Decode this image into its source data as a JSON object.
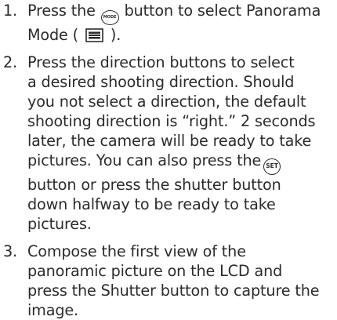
{
  "steps": [
    {
      "number": "1.",
      "text_before_icon": "Press the ",
      "icon_label": "MODE",
      "text_after_icon": " button to select Panorama",
      "line2_before_icon": "Mode ( ",
      "line2_after_icon": " )."
    },
    {
      "number": "2.",
      "lines": [
        "Press the direction buttons to select",
        "a desired shooting direction. Should",
        "you not select a direction, the default",
        "shooting direction is “right.” 2 seconds",
        "later, the camera will be ready to take"
      ],
      "line6_before_icon": "pictures. You can also press the",
      "icon_label": "SET",
      "lines_after": [
        "button or press the shutter button",
        "down halfway to be ready to take",
        "pictures."
      ]
    },
    {
      "number": "3.",
      "lines": [
        "Compose the first view of the",
        "panoramic picture on the LCD and",
        "press the Shutter button to capture the",
        "image."
      ]
    }
  ],
  "icons": {
    "mode_button": "mode-button-icon",
    "set_button": "set-button-icon",
    "panorama_mode": "panorama-mode-icon"
  },
  "colors": {
    "text": "#2b2b2b",
    "background": "#ffffff"
  }
}
